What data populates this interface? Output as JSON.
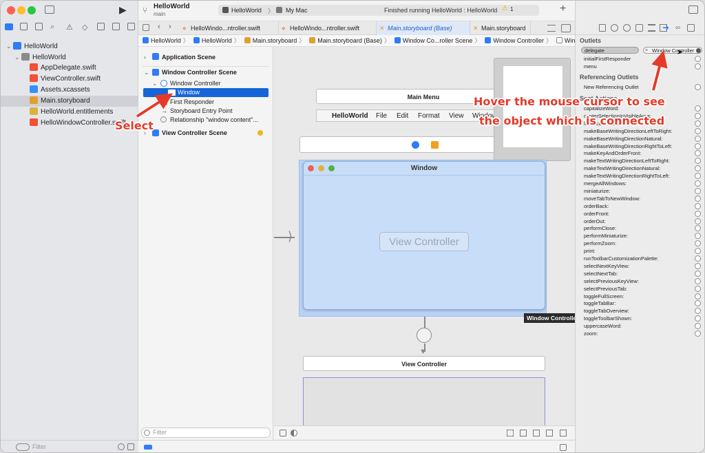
{
  "toolbar": {
    "project": "HelloWorld",
    "branch": "main",
    "scheme": "HelloWorld",
    "destination": "My Mac",
    "status": "Finished running HelloWorld : HelloWorld",
    "warning_count": "1"
  },
  "navigator": {
    "items": [
      {
        "label": "HelloWorld",
        "level": 0,
        "color": "#2f7cf6"
      },
      {
        "label": "HelloWorld",
        "level": 1,
        "color": "#8a8a8a"
      },
      {
        "label": "AppDelegate.swift",
        "level": 2,
        "color": "#f05138"
      },
      {
        "label": "ViewController.swift",
        "level": 2,
        "color": "#f05138"
      },
      {
        "label": "Assets.xcassets",
        "level": 2,
        "color": "#3a8ef6"
      },
      {
        "label": "Main.storyboard",
        "level": 2,
        "color": "#e0a030"
      },
      {
        "label": "HelloWorld.entitlements",
        "level": 2,
        "color": "#d9b33b"
      },
      {
        "label": "HelloWindowController.swift",
        "level": 2,
        "color": "#f05138"
      }
    ],
    "filter_placeholder": "Filter"
  },
  "tabs": [
    "HelloWindo...ntroller.swift",
    "HelloWindo...ntroller.swift",
    "Main.storyboard (Base)",
    "Main.storyboard"
  ],
  "jumpbar": [
    "HelloWorld",
    "HelloWorld",
    "Main.storyboard",
    "Main.storyboard (Base)",
    "Window Co...roller Scene",
    "Window Controller",
    "Window"
  ],
  "outline": {
    "app_scene": "Application Scene",
    "wc_scene": "Window Controller Scene",
    "wc": "Window Controller",
    "window": "Window",
    "first_responder": "First Responder",
    "entry_point": "Storyboard Entry Point",
    "relationship": "Relationship \"window content\"...",
    "vc_scene": "View Controller Scene",
    "filter_placeholder": "Filter"
  },
  "canvas": {
    "main_menu": "Main Menu",
    "menu_items": [
      "HelloWorld",
      "File",
      "Edit",
      "Format",
      "View",
      "Window"
    ],
    "window_title": "Window",
    "vc_label": "View Controller",
    "vc_title": "View Controller",
    "tooltip": "Window Controller"
  },
  "inspector": {
    "outlets_header": "Outlets",
    "outlets": [
      {
        "name": "delegate",
        "connected": "Window Controller"
      },
      {
        "name": "initialFirstResponder"
      },
      {
        "name": "menu"
      }
    ],
    "ref_header": "Referencing Outlets",
    "new_ref": "New Referencing Outlet",
    "actions_header": "Sent Actions",
    "actions": [
      "capitalizeWord:",
      "centerSelectionInVisibleArea:",
      "lowercaseWord:",
      "makeBaseWritingDirectionLeftToRight:",
      "makeBaseWritingDirectionNatural:",
      "makeBaseWritingDirectionRightToLeft:",
      "makeKeyAndOrderFront:",
      "makeTextWritingDirectionLeftToRight:",
      "makeTextWritingDirectionNatural:",
      "makeTextWritingDirectionRightToLeft:",
      "mergeAllWindows:",
      "miniaturize:",
      "moveTabToNewWindow:",
      "orderBack:",
      "orderFront:",
      "orderOut:",
      "performClose:",
      "performMiniaturize:",
      "performZoom:",
      "print:",
      "runToolbarCustomizationPalette:",
      "selectNextKeyView:",
      "selectNextTab:",
      "selectPreviousKeyView:",
      "selectPreviousTab:",
      "toggleFullScreen:",
      "toggleTabBar:",
      "toggleTabOverview:",
      "toggleToolbarShown:",
      "uppercaseWord:",
      "zoom:"
    ]
  },
  "annotations": {
    "select": "Select",
    "hover_line1": "Hover the mouse cursor to see",
    "hover_line2": "the object which is connected"
  },
  "colors": {
    "accent": "#2f7cf6",
    "annotation": "#e53a2a",
    "selection": "#1565d8"
  }
}
